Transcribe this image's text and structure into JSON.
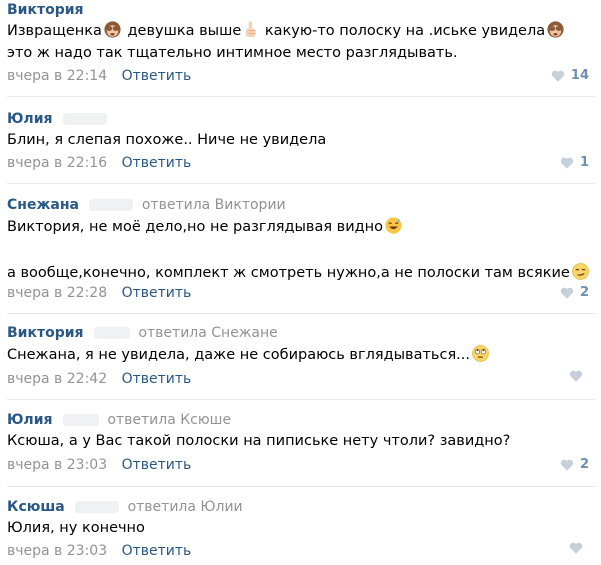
{
  "comments": [
    {
      "author": "Виктория",
      "reply_to": "",
      "text_line1_a": "Извращенка",
      "text_line1_b": " девушка выше",
      "text_line1_c": " какую-то полоску на .иське увидела",
      "text_line2": "это ж надо так тщательно интимное место разглядывать.",
      "date": "вчера в 22:14",
      "reply_label": "Ответить",
      "likes": "14"
    },
    {
      "author": "Юлия",
      "reply_to": "",
      "text_line1": "Блин, я слепая похоже.. Ниче не увидела",
      "date": "вчера в 22:16",
      "reply_label": "Ответить",
      "likes": "1"
    },
    {
      "author": "Снежана",
      "reply_to": "ответила Виктории",
      "text_line1": "Виктория, не моё дело,но не разглядывая видно",
      "text_line3": "а вообще,конечно, комплект ж смотреть нужно,а не полоски там всякие",
      "date": "вчера в 22:28",
      "reply_label": "Ответить",
      "likes": "2"
    },
    {
      "author": "Виктория",
      "reply_to": "ответила Снежане",
      "text_line1": "Снежана, я не увидела, даже не собираюсь вглядываться...",
      "date": "вчера в 22:42",
      "reply_label": "Ответить",
      "likes": ""
    },
    {
      "author": "Юлия",
      "reply_to": "ответила Ксюше",
      "text_line1": "Ксюша, а у Вас такой полоски на пипиське нету чтоли? завидно?",
      "date": "вчера в 23:03",
      "reply_label": "Ответить",
      "likes": "2"
    },
    {
      "author": "Ксюша",
      "reply_to": "ответила Юлии",
      "text_line1": "Юлия, ну конечно",
      "date": "вчера в 23:03",
      "reply_label": "Ответить",
      "likes": ""
    }
  ],
  "icons": {
    "like": "heart-icon",
    "emoji": [
      "see-no-evil-monkey-icon",
      "pointing-up-hand-icon",
      "sweat-smile-emoji-icon",
      "smirk-emoji-icon",
      "eye-roll-emoji-icon"
    ]
  },
  "colors": {
    "author": "#2a5885",
    "meta": "#939393",
    "like": "#6d8fb3",
    "divider": "#e7e8ec"
  }
}
